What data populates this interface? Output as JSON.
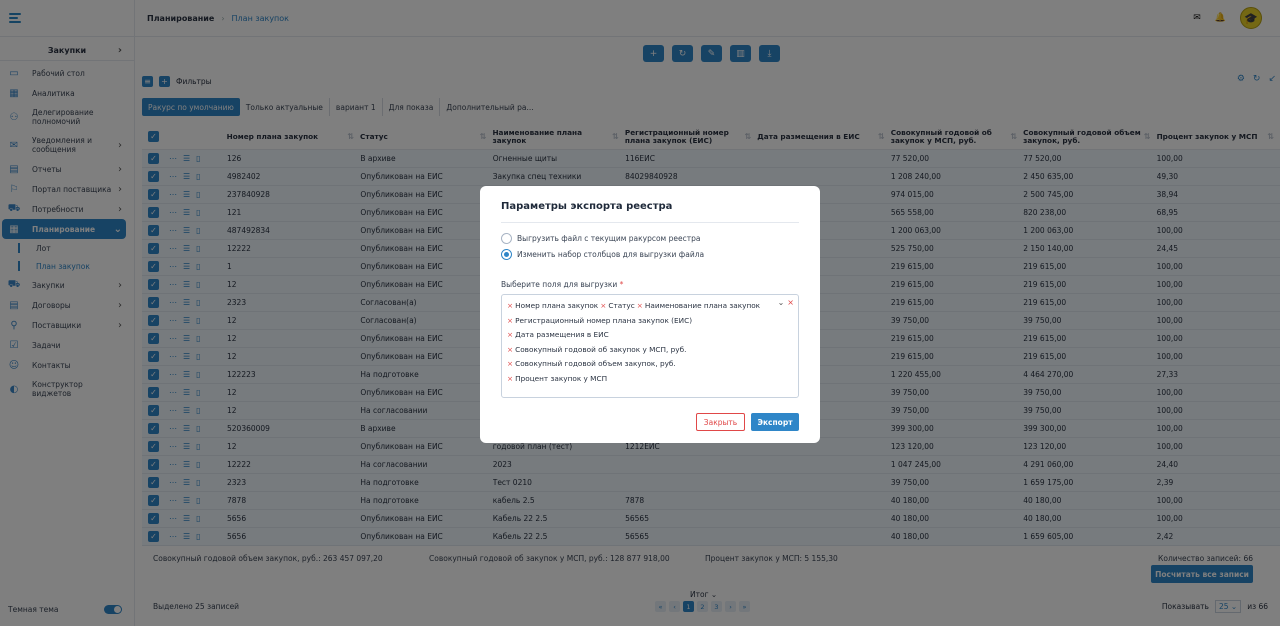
{
  "sidebar": {
    "module": "Закупки",
    "items": [
      {
        "label": "Рабочий стол",
        "icon": "desktop-icon",
        "glyph": "▭",
        "chev": false
      },
      {
        "label": "Аналитика",
        "icon": "chart-icon",
        "glyph": "▦",
        "chev": false
      },
      {
        "label": "Делегирование полномочий",
        "icon": "delegation-icon",
        "glyph": "⚇",
        "chev": false
      },
      {
        "label": "Уведомления и сообщения",
        "icon": "mail-icon",
        "glyph": "✉",
        "chev": true
      },
      {
        "label": "Отчеты",
        "icon": "report-icon",
        "glyph": "▤",
        "chev": true
      },
      {
        "label": "Портал поставщика",
        "icon": "portal-icon",
        "glyph": "⚐",
        "chev": true
      },
      {
        "label": "Потребности",
        "icon": "cart-icon",
        "glyph": "⛟",
        "chev": true
      }
    ],
    "active": {
      "label": "Планирование",
      "icon": "calendar-icon",
      "glyph": "▦"
    },
    "subitems": [
      "Лот",
      "План закупок"
    ],
    "items2": [
      {
        "label": "Закупки",
        "icon": "truck-icon",
        "glyph": "⛟",
        "chev": true
      },
      {
        "label": "Договоры",
        "icon": "contract-icon",
        "glyph": "▤",
        "chev": true
      },
      {
        "label": "Поставщики",
        "icon": "supplier-icon",
        "glyph": "⚲",
        "chev": true
      },
      {
        "label": "Задачи",
        "icon": "tasks-icon",
        "glyph": "☑",
        "chev": false
      },
      {
        "label": "Контакты",
        "icon": "contacts-icon",
        "glyph": "☺",
        "chev": false
      },
      {
        "label": "Конструктор виджетов",
        "icon": "widget-icon",
        "glyph": "◐",
        "chev": false
      }
    ],
    "theme_label": "Темная тема"
  },
  "header": {
    "breadcrumb1": "Планирование",
    "breadcrumb2": "План закупок"
  },
  "filters_label": "Фильтры",
  "tabs": [
    "Ракурс по умолчанию",
    "Только актуальные",
    "вариант 1",
    "Для показа",
    "Дополнительный ра..."
  ],
  "columns": [
    {
      "label": "Номер плана закупок",
      "w": 134
    },
    {
      "label": "Статус",
      "w": 133
    },
    {
      "label": "Наименование плана закупок",
      "w": 133
    },
    {
      "label": "Регистрационный номер плана закупок (ЕИС)",
      "w": 133
    },
    {
      "label": "Дата размещения в ЕИС",
      "w": 134
    },
    {
      "label": "Совокупный годовой об закупок у МСП, руб.",
      "w": 133
    },
    {
      "label": "Совокупный годовой объем закупок, руб.",
      "w": 134
    },
    {
      "label": "Процент закупок у МСП",
      "w": 124
    }
  ],
  "rows": [
    [
      "126",
      "В архиве",
      "Огненные щиты",
      "116ЕИС",
      "",
      "77 520,00",
      "77 520,00",
      "100,00"
    ],
    [
      "4982402",
      "Опубликован на ЕИС",
      "Закупка спец техники",
      "84029840928",
      "",
      "1 208 240,00",
      "2 450 635,00",
      "49,30"
    ],
    [
      "237840928",
      "Опубликован на ЕИС",
      "",
      "",
      "",
      "974 015,00",
      "2 500 745,00",
      "38,94"
    ],
    [
      "121",
      "Опубликован на ЕИС",
      "",
      "",
      "",
      "565 558,00",
      "820 238,00",
      "68,95"
    ],
    [
      "487492834",
      "Опубликован на ЕИС",
      "",
      "",
      "",
      "1 200 063,00",
      "1 200 063,00",
      "100,00"
    ],
    [
      "12222",
      "Опубликован на ЕИС",
      "",
      "",
      "",
      "525 750,00",
      "2 150 140,00",
      "24,45"
    ],
    [
      "1",
      "Опубликован на ЕИС",
      "",
      "",
      "",
      "219 615,00",
      "219 615,00",
      "100,00"
    ],
    [
      "12",
      "Опубликован на ЕИС",
      "",
      "",
      "",
      "219 615,00",
      "219 615,00",
      "100,00"
    ],
    [
      "2323",
      "Согласован(а)",
      "",
      "",
      "",
      "219 615,00",
      "219 615,00",
      "100,00"
    ],
    [
      "12",
      "Согласован(а)",
      "",
      "",
      "",
      "39 750,00",
      "39 750,00",
      "100,00"
    ],
    [
      "12",
      "Опубликован на ЕИС",
      "",
      "",
      "",
      "219 615,00",
      "219 615,00",
      "100,00"
    ],
    [
      "12",
      "Опубликован на ЕИС",
      "",
      "",
      "",
      "219 615,00",
      "219 615,00",
      "100,00"
    ],
    [
      "122223",
      "На подготовке",
      "",
      "",
      "",
      "1 220 455,00",
      "4 464 270,00",
      "27,33"
    ],
    [
      "12",
      "Опубликован на ЕИС",
      "",
      "",
      "",
      "39 750,00",
      "39 750,00",
      "100,00"
    ],
    [
      "12",
      "На согласовании",
      "",
      "",
      "",
      "39 750,00",
      "39 750,00",
      "100,00"
    ],
    [
      "520360009",
      "В архиве",
      "",
      "",
      "",
      "399 300,00",
      "399 300,00",
      "100,00"
    ],
    [
      "12",
      "Опубликован на ЕИС",
      "годовой план (тест)",
      "1212ЕИС",
      "",
      "123 120,00",
      "123 120,00",
      "100,00"
    ],
    [
      "12222",
      "На согласовании",
      "2023",
      "",
      "",
      "1 047 245,00",
      "4 291 060,00",
      "24,40"
    ],
    [
      "2323",
      "На подготовке",
      "Тест 0210",
      "",
      "",
      "39 750,00",
      "1 659 175,00",
      "2,39"
    ],
    [
      "7878",
      "На подготовке",
      "кабель 2.5",
      "7878",
      "",
      "40 180,00",
      "40 180,00",
      "100,00"
    ],
    [
      "5656",
      "Опубликован на ЕИС",
      "Кабель 22 2.5",
      "56565",
      "",
      "40 180,00",
      "40 180,00",
      "100,00"
    ],
    [
      "5656",
      "Опубликован на ЕИС",
      "Кабель 22 2.5",
      "56565",
      "",
      "40 180,00",
      "1 659 605,00",
      "2,42"
    ]
  ],
  "footer": {
    "total_volume": "Совокупный годовой объем закупок, руб.: 263 457 097,20",
    "msp_volume": "Совокупный годовой об закупок у МСП, руб.: 128 877 918,00",
    "msp_percent": "Процент закупок у МСП: 5 155,30",
    "records": "Количество записей: 66",
    "count_all": "Посчитать все записи",
    "selected": "Выделено 25 записей",
    "itog": "Итог",
    "show_label": "Показывать",
    "per_page": "25",
    "of_total": "из 66",
    "pages": [
      "1",
      "2",
      "3"
    ]
  },
  "modal": {
    "title": "Параметры экспорта реестра",
    "option1": "Выгрузить файл с текущим ракурсом реестра",
    "option2": "Изменить набор столбцов для выгрузки файла",
    "selected_option": 2,
    "fields_label": "Выберите поля для выгрузки",
    "required_mark": "*",
    "chips": [
      "Номер плана закупок",
      "Статус",
      "Наименование плана закупок",
      "Регистрационный номер плана закупок (ЕИС)",
      "Дата размещения в ЕИС",
      "Совокупный годовой об закупок у МСП, руб.",
      "Совокупный годовой объем закупок, руб.",
      "Процент закупок у МСП"
    ],
    "close_label": "Закрыть",
    "export_label": "Экспорт"
  }
}
